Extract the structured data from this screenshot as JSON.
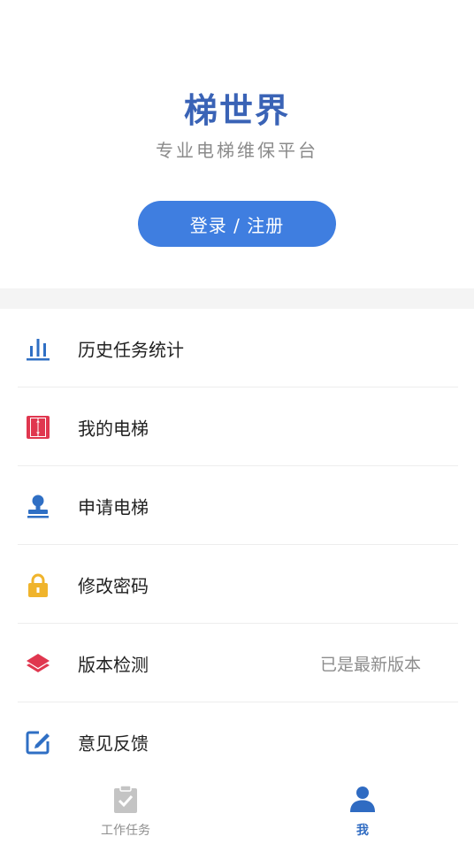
{
  "brand": {
    "title": "梯世界",
    "subtitle": "专业电梯维保平台",
    "login_label": "登录 / 注册",
    "title_color": "#3a63b6",
    "button_color": "#3f7ee0"
  },
  "menu": {
    "items": [
      {
        "label": "历史任务统计",
        "icon": "bar-chart-icon",
        "icon_color": "#2f6fc4"
      },
      {
        "label": "我的电梯",
        "icon": "elevator-icon",
        "icon_color": "#e0374f"
      },
      {
        "label": "申请电梯",
        "icon": "stamp-icon",
        "icon_color": "#2f6fc4"
      },
      {
        "label": "修改密码",
        "icon": "lock-icon",
        "icon_color": "#f0b42c"
      },
      {
        "label": "版本检测",
        "icon": "layers-icon",
        "icon_color": "#e0374f",
        "value": "已是最新版本"
      },
      {
        "label": "意见反馈",
        "icon": "edit-icon",
        "icon_color": "#2f6fc4"
      }
    ]
  },
  "tabbar": {
    "tabs": [
      {
        "label": "工作任务",
        "icon": "clipboard-check-icon",
        "active": false
      },
      {
        "label": "我",
        "icon": "user-icon",
        "active": true
      }
    ],
    "active_color": "#2f6bc2",
    "inactive_color": "#8f8f8f"
  }
}
